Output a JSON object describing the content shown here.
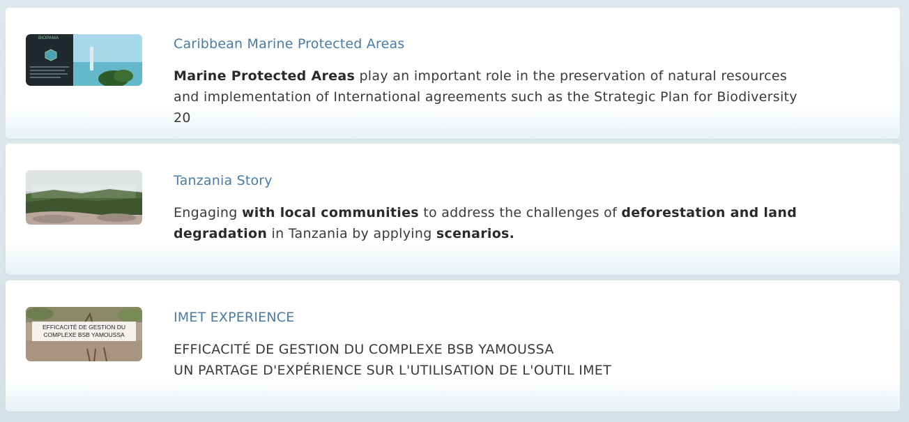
{
  "cards": [
    {
      "title": "Caribbean Marine Protected Areas",
      "desc": {
        "b1": "Marine Protected Areas",
        "t1": " play an important role in the preservation of natural resources and implementation of International agreements such as the Strategic Plan for Biodiversity 20"
      },
      "thumb_text": "BIOPAMA"
    },
    {
      "title": "Tanzania Story",
      "desc": {
        "t1": "Engaging ",
        "b1": "with local communities",
        "t2": " to address the challenges of ",
        "b2": "deforestation and land degradation",
        "t3": " in Tanzania by applying ",
        "b3": "scenarios."
      }
    },
    {
      "title": "IMET EXPERIENCE",
      "desc": {
        "line1": "EFFICACITÉ DE GESTION DU COMPLEXE BSB YAMOUSSA",
        "line2": "UN PARTAGE D'EXPÉRIENCE SUR L'UTILISATION DE L'OUTIL IMET"
      },
      "thumb_text": {
        "line1": "EFFICACITÉ DE GESTION DU",
        "line2": "COMPLEXE BSB  YAMOUSSA"
      }
    }
  ],
  "colors": {
    "title": "#4a7ba6",
    "text": "#3a3a3a"
  }
}
